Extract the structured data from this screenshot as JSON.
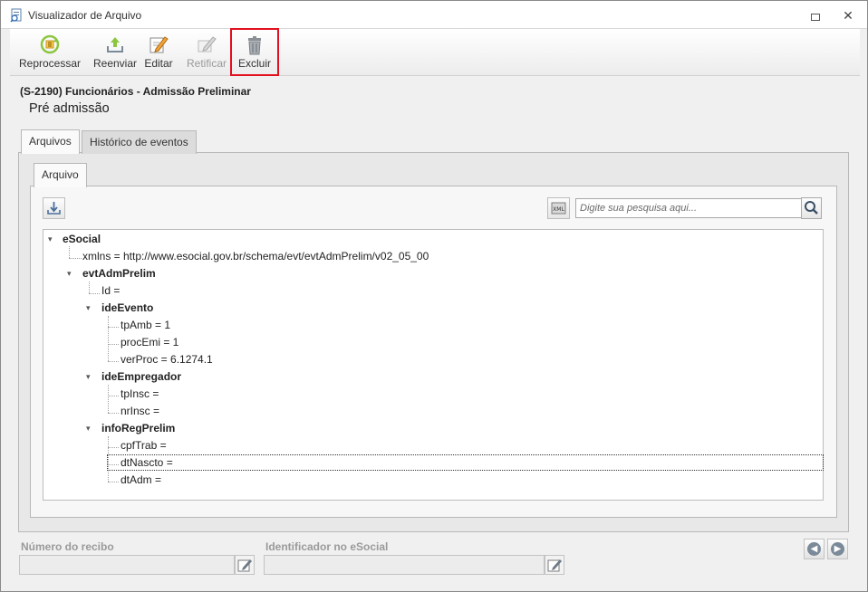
{
  "window": {
    "title": "Visualizador de Arquivo",
    "icons": {
      "app": "document-viewer-icon",
      "restore": "restore-icon",
      "close": "close-icon"
    },
    "close_glyph": "✕"
  },
  "toolbar": {
    "reprocessar": "Reprocessar",
    "reenviar": "Reenviar",
    "editar": "Editar",
    "retificar": "Retificar",
    "excluir": "Excluir",
    "highlight_color": "#e3101f"
  },
  "header": {
    "title": "(S-2190) Funcionários - Admissão Preliminar",
    "subtitle": "Pré admissão"
  },
  "tabs": {
    "arquivos": "Arquivos",
    "historico": "Histórico de eventos",
    "arquivo": "Arquivo"
  },
  "search": {
    "placeholder": "Digite sua pesquisa aqui..."
  },
  "tree": {
    "esocial": "eSocial",
    "xmlns": "xmlns = http://www.esocial.gov.br/schema/evt/evtAdmPrelim/v02_05_00",
    "evtAdmPrelim": "evtAdmPrelim",
    "id": "Id =",
    "ideEvento": "ideEvento",
    "tpAmb": "tpAmb = 1",
    "procEmi": "procEmi = 1",
    "verProc": "verProc = 6.1274.1",
    "ideEmpregador": "ideEmpregador",
    "tpInsc": "tpInsc =",
    "nrInsc": "nrInsc =",
    "infoRegPrelim": "infoRegPrelim",
    "cpfTrab": "cpfTrab =",
    "dtNascto": "dtNascto =",
    "dtAdm": "dtAdm =",
    "expand_glyph": "▾"
  },
  "bottom": {
    "numero_recibo_label": "Número do recibo",
    "numero_recibo_value": "",
    "identificador_label": "Identificador no eSocial",
    "identificador_value": "",
    "prev_glyph": "◀",
    "next_glyph": "▶"
  }
}
